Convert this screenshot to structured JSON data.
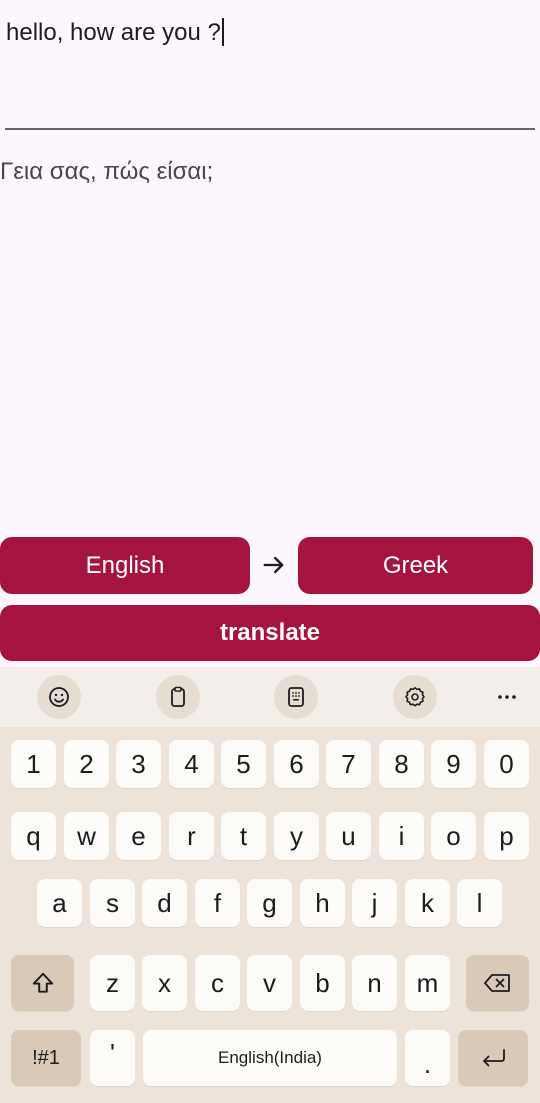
{
  "input": {
    "value": "hello, how are you ?"
  },
  "output": {
    "text": "Γεια σας, πώς είσαι;"
  },
  "languages": {
    "from": "English",
    "to": "Greek"
  },
  "actions": {
    "translate_label": "translate"
  },
  "colors": {
    "accent": "#a5133f",
    "background": "#fdf6fd",
    "keyboard": "#ede3d8",
    "special_key": "#d9c9b6"
  },
  "keyboard": {
    "toolbar": [
      "emoji-icon",
      "clipboard-icon",
      "keypad-icon",
      "settings-icon",
      "more-icon"
    ],
    "row_numbers": [
      "1",
      "2",
      "3",
      "4",
      "5",
      "6",
      "7",
      "8",
      "9",
      "0"
    ],
    "row_top": [
      "q",
      "w",
      "e",
      "r",
      "t",
      "y",
      "u",
      "i",
      "o",
      "p"
    ],
    "row_middle": [
      "a",
      "s",
      "d",
      "f",
      "g",
      "h",
      "j",
      "k",
      "l"
    ],
    "row_bottom": [
      "z",
      "x",
      "c",
      "v",
      "b",
      "n",
      "m"
    ],
    "symbols_label": "!#1",
    "comma_label": "'",
    "space_label": "English(India)",
    "period_label": "."
  }
}
